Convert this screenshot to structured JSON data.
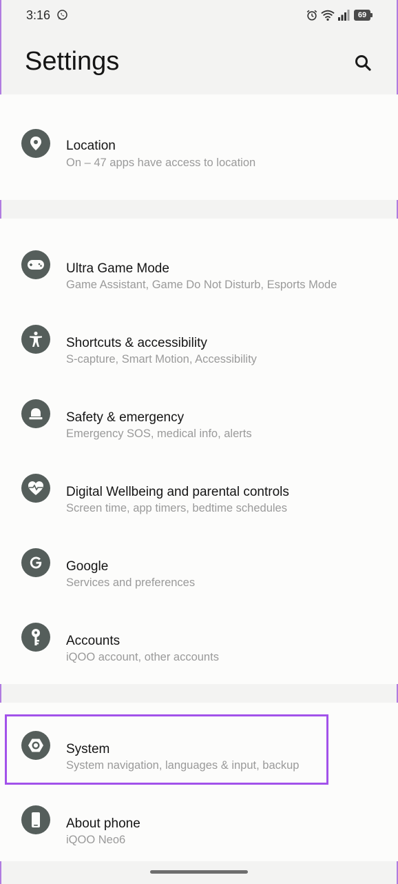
{
  "status_bar": {
    "time": "3:16",
    "battery_level": "69",
    "icons": [
      "whatsapp-icon",
      "alarm-icon",
      "wifi-icon",
      "signal-icon",
      "battery-icon"
    ]
  },
  "header": {
    "title": "Settings",
    "search_icon": "search-icon"
  },
  "groups": [
    {
      "items": [
        {
          "title": "Location",
          "subtitle": "On – 47 apps have access to location",
          "icon": "location-pin-icon"
        }
      ]
    },
    {
      "items": [
        {
          "title": "Ultra Game Mode",
          "subtitle": "Game Assistant, Game Do Not Disturb, Esports Mode",
          "icon": "gamepad-icon"
        },
        {
          "title": "Shortcuts & accessibility",
          "subtitle": "S-capture, Smart Motion, Accessibility",
          "icon": "accessibility-icon"
        },
        {
          "title": "Safety & emergency",
          "subtitle": "Emergency SOS, medical info, alerts",
          "icon": "emergency-light-icon"
        },
        {
          "title": "Digital Wellbeing and parental controls",
          "subtitle": "Screen time, app timers, bedtime schedules",
          "icon": "heart-icon"
        },
        {
          "title": "Google",
          "subtitle": "Services and preferences",
          "icon": "google-icon"
        },
        {
          "title": "Accounts",
          "subtitle": "iQOO account, other accounts",
          "icon": "key-icon"
        }
      ]
    },
    {
      "items": [
        {
          "title": "System",
          "subtitle": "System navigation, languages & input, backup",
          "icon": "system-gear-icon",
          "highlighted": true
        },
        {
          "title": "About phone",
          "subtitle": "iQOO Neo6",
          "icon": "phone-icon"
        }
      ]
    }
  ],
  "colors": {
    "icon_bg": "#555e5b",
    "highlight": "#a252ea",
    "page_bg": "#f3f3f2",
    "card_bg": "#fcfcfb"
  }
}
